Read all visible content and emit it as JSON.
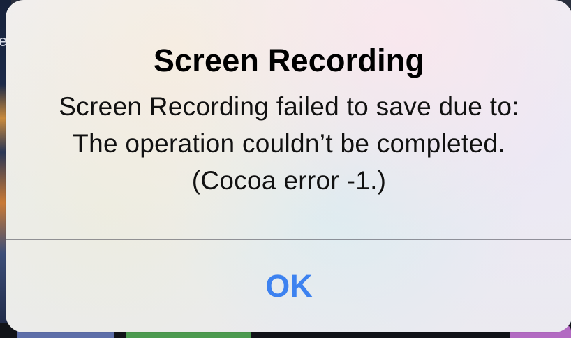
{
  "background": {
    "edge_char": "e"
  },
  "alert": {
    "title": "Screen Recording",
    "message_lines": [
      "Screen Recording failed to save due to:",
      "The operation couldn’t be completed.",
      "(Cocoa error -1.)"
    ],
    "ok_label": "OK"
  },
  "colors": {
    "ok_button_text": "#3d82f0",
    "title_text": "#000000",
    "message_text": "#111111"
  }
}
